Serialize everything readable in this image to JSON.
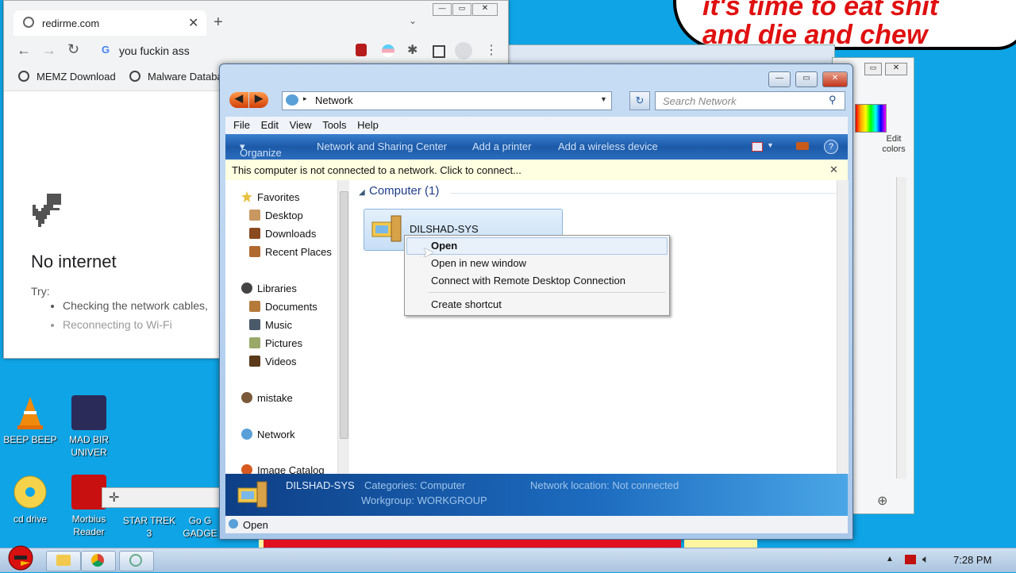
{
  "bubble": {
    "line1": "it's time to eat shit",
    "line2": "and die and chew"
  },
  "chrome": {
    "tab_title": "redirme.com",
    "address": "you fuckin ass",
    "bookmarks": [
      "MEMZ Download",
      "Malware Databa"
    ],
    "heading": "No internet",
    "try": "Try:",
    "suggestions": [
      "Checking the network cables,",
      "Reconnecting to Wi-Fi"
    ]
  },
  "explorer": {
    "breadcrumb": "Network",
    "search_placeholder": "Search Network",
    "menu": [
      "File",
      "Edit",
      "View",
      "Tools",
      "Help"
    ],
    "commands": [
      "Organize",
      "Network and Sharing Center",
      "Add a printer",
      "Add a wireless device"
    ],
    "infobar": "This computer is not connected to a network. Click to connect...",
    "nav": {
      "favorites": "Favorites",
      "desktop": "Desktop",
      "downloads": "Downloads",
      "recent": "Recent Places",
      "libraries": "Libraries",
      "documents": "Documents",
      "music": "Music",
      "pictures": "Pictures",
      "videos": "Videos",
      "mistake": "mistake",
      "network": "Network",
      "image_catalog": "Image Catalog"
    },
    "group_header": "Computer (1)",
    "item_name": "DILSHAD-SYS",
    "details": {
      "name": "DILSHAD-SYS",
      "categories_label": "Categories:",
      "categories_value": "Computer",
      "location_label": "Network location:",
      "location_value": "Not connected",
      "workgroup_label": "Workgroup:",
      "workgroup_value": "WORKGROUP"
    },
    "status": "Open"
  },
  "context_menu": {
    "open": "Open",
    "open_new": "Open in new window",
    "rdp": "Connect with Remote Desktop Connection",
    "shortcut": "Create shortcut"
  },
  "paint": {
    "edit_colors": "Edit\ncolors"
  },
  "desktop_icons": {
    "beep": "BEEP BEEP",
    "mad_bird_1": "MAD BIR",
    "mad_bird_2": "UNIVER",
    "cd": "cd drive",
    "morbius_1": "Morbius",
    "morbius_2": "Reader",
    "startrek_1": "STAR TREK",
    "startrek_2": "3",
    "gadget_1": "Go G",
    "gadget_2": "GADGE"
  },
  "taskbar": {
    "clock": "7:28 PM"
  }
}
